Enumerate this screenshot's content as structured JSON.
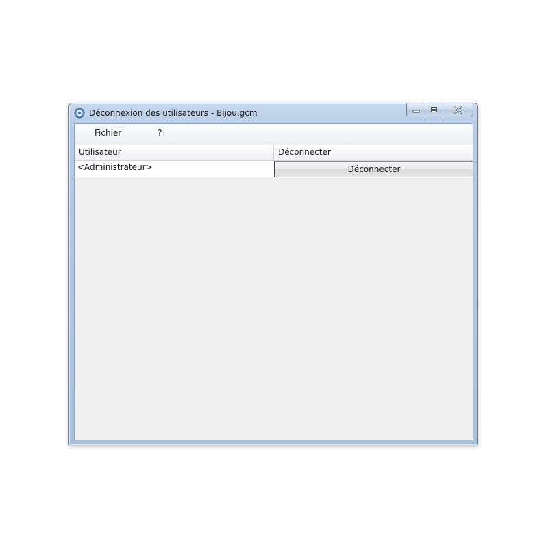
{
  "window": {
    "title": "Déconnexion des utilisateurs - Bijou.gcm",
    "caption_buttons": {
      "minimize": "minimize-icon",
      "maximize": "maximize-icon",
      "close": "close-icon"
    }
  },
  "menu": {
    "items": [
      "Fichier",
      "?"
    ]
  },
  "grid": {
    "columns": [
      "Utilisateur",
      "Déconnecter"
    ],
    "rows": [
      {
        "user": "<Administrateur>",
        "action_label": "Déconnecter"
      }
    ]
  },
  "colors": {
    "client_background": "#f0f0f0",
    "titlebar": "#b6cbe4"
  }
}
